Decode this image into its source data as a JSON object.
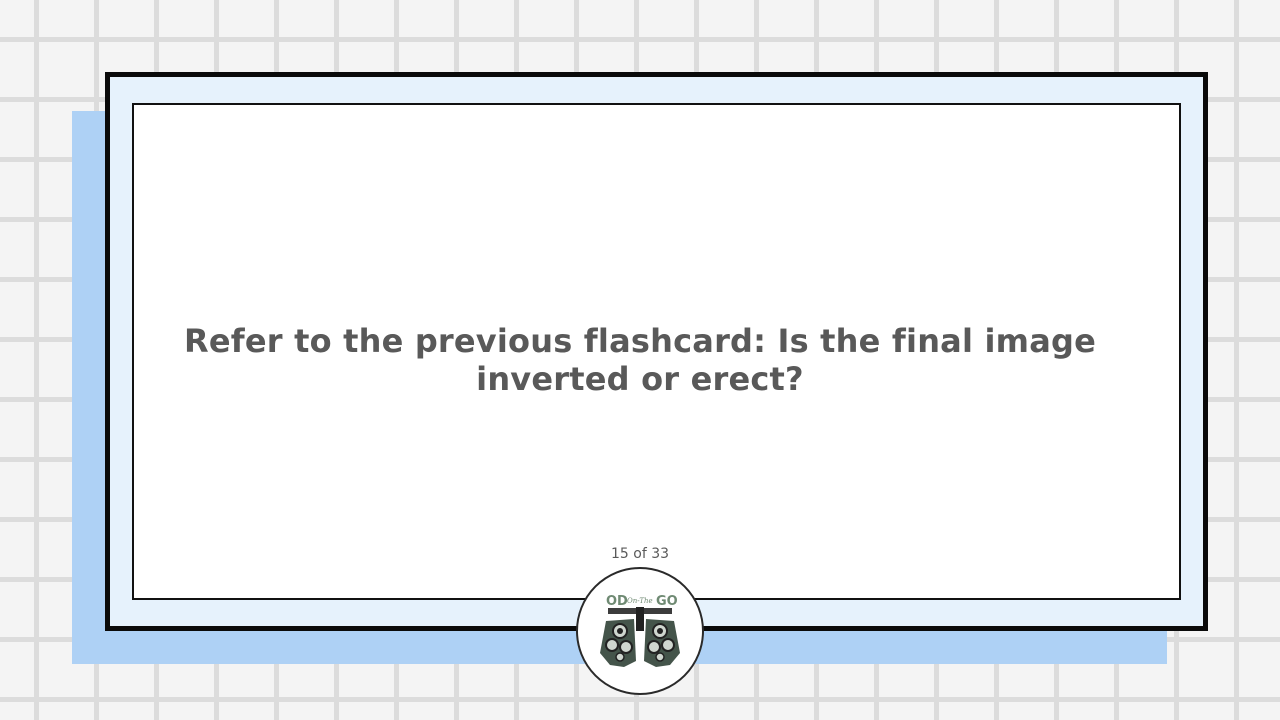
{
  "card": {
    "question": "Refer to the previous flashcard: Is the final image inverted or erect?",
    "counter": "15 of 33"
  },
  "logo": {
    "text_od": "OD",
    "text_on_the": "On-The",
    "text_go": "GO",
    "icon": "phoropter-icon"
  },
  "colors": {
    "background": "#f4f4f4",
    "grid_lines": "#dcdcdc",
    "card_shadow": "#aed1f5",
    "card_frame": "#e6f2fc",
    "text": "#595959",
    "logo_green": "#6f8a73"
  }
}
